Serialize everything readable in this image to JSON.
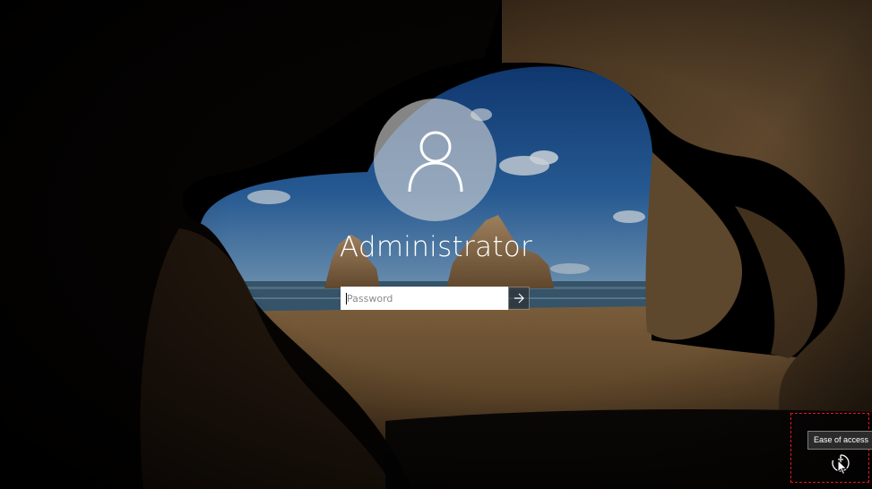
{
  "login": {
    "username": "Administrator",
    "password_placeholder": "Password"
  },
  "ease_of_access": {
    "tooltip": "Ease of access"
  },
  "icons": {
    "avatar": "user-icon",
    "submit": "arrow-right-icon",
    "ease_of_access": "ease-of-access-icon",
    "cursor": "mouse-pointer-icon"
  },
  "colors": {
    "highlight_border": "#e0181f",
    "tooltip_bg": "#2b2b2b"
  }
}
